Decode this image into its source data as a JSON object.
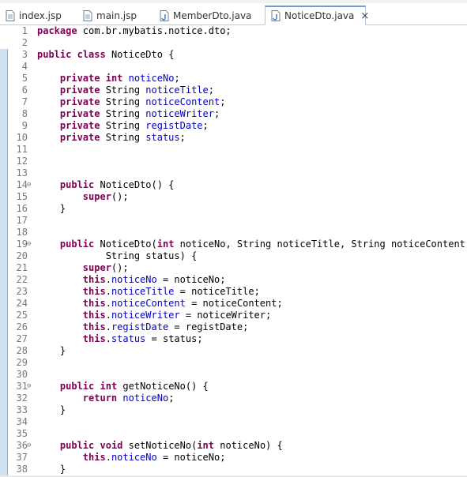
{
  "tabs": [
    {
      "label": "index.jsp",
      "icon": "jsp-file-icon",
      "active": false
    },
    {
      "label": "main.jsp",
      "icon": "jsp-file-icon",
      "active": false
    },
    {
      "label": "MemberDto.java",
      "icon": "java-file-icon",
      "active": false
    },
    {
      "label": "NoticeDto.java",
      "icon": "java-file-icon",
      "active": true,
      "close": "×"
    }
  ],
  "colors": {
    "keyword": "#7f0055",
    "field": "#0000c0",
    "plain": "#000000",
    "line_number": "#787878",
    "change_bar": "#cfe0f1"
  },
  "code_lines": [
    {
      "n": "1",
      "segs": [
        [
          "kw",
          "package"
        ],
        [
          "t",
          " com.br.mybatis.notice.dto;"
        ]
      ]
    },
    {
      "n": "2",
      "segs": []
    },
    {
      "n": "3",
      "segs": [
        [
          "kw",
          "public"
        ],
        [
          "t",
          " "
        ],
        [
          "kw",
          "class"
        ],
        [
          "t",
          " NoticeDto {"
        ]
      ]
    },
    {
      "n": "4",
      "segs": []
    },
    {
      "n": "5",
      "segs": [
        [
          "t",
          "    "
        ],
        [
          "kw",
          "private"
        ],
        [
          "t",
          " "
        ],
        [
          "kw",
          "int"
        ],
        [
          "t",
          " "
        ],
        [
          "fd",
          "noticeNo"
        ],
        [
          "t",
          ";"
        ]
      ]
    },
    {
      "n": "6",
      "segs": [
        [
          "t",
          "    "
        ],
        [
          "kw",
          "private"
        ],
        [
          "t",
          " String "
        ],
        [
          "fd",
          "noticeTitle"
        ],
        [
          "t",
          ";"
        ]
      ]
    },
    {
      "n": "7",
      "segs": [
        [
          "t",
          "    "
        ],
        [
          "kw",
          "private"
        ],
        [
          "t",
          " String "
        ],
        [
          "fd",
          "noticeContent"
        ],
        [
          "t",
          ";"
        ]
      ]
    },
    {
      "n": "8",
      "segs": [
        [
          "t",
          "    "
        ],
        [
          "kw",
          "private"
        ],
        [
          "t",
          " String "
        ],
        [
          "fd",
          "noticeWriter"
        ],
        [
          "t",
          ";"
        ]
      ]
    },
    {
      "n": "9",
      "segs": [
        [
          "t",
          "    "
        ],
        [
          "kw",
          "private"
        ],
        [
          "t",
          " String "
        ],
        [
          "fd",
          "registDate"
        ],
        [
          "t",
          ";"
        ]
      ]
    },
    {
      "n": "10",
      "segs": [
        [
          "t",
          "    "
        ],
        [
          "kw",
          "private"
        ],
        [
          "t",
          " String "
        ],
        [
          "fd",
          "status"
        ],
        [
          "t",
          ";"
        ]
      ]
    },
    {
      "n": "11",
      "segs": []
    },
    {
      "n": "12",
      "segs": []
    },
    {
      "n": "13",
      "segs": []
    },
    {
      "n": "14",
      "fold": "⊖",
      "segs": [
        [
          "t",
          "    "
        ],
        [
          "kw",
          "public"
        ],
        [
          "t",
          " NoticeDto() {"
        ]
      ]
    },
    {
      "n": "15",
      "segs": [
        [
          "t",
          "        "
        ],
        [
          "kw",
          "super"
        ],
        [
          "t",
          "();"
        ]
      ]
    },
    {
      "n": "16",
      "segs": [
        [
          "t",
          "    }"
        ]
      ]
    },
    {
      "n": "17",
      "segs": []
    },
    {
      "n": "18",
      "segs": []
    },
    {
      "n": "19",
      "fold": "⊖",
      "segs": [
        [
          "t",
          "    "
        ],
        [
          "kw",
          "public"
        ],
        [
          "t",
          " NoticeDto("
        ],
        [
          "kw",
          "int"
        ],
        [
          "t",
          " noticeNo, String noticeTitle, String noticeContent, String noticeWriter, String registDate,"
        ]
      ]
    },
    {
      "n": "20",
      "segs": [
        [
          "t",
          "            String status) {"
        ]
      ]
    },
    {
      "n": "21",
      "segs": [
        [
          "t",
          "        "
        ],
        [
          "kw",
          "super"
        ],
        [
          "t",
          "();"
        ]
      ]
    },
    {
      "n": "22",
      "segs": [
        [
          "t",
          "        "
        ],
        [
          "kw",
          "this"
        ],
        [
          "t",
          "."
        ],
        [
          "fd",
          "noticeNo"
        ],
        [
          "t",
          " = noticeNo;"
        ]
      ]
    },
    {
      "n": "23",
      "segs": [
        [
          "t",
          "        "
        ],
        [
          "kw",
          "this"
        ],
        [
          "t",
          "."
        ],
        [
          "fd",
          "noticeTitle"
        ],
        [
          "t",
          " = noticeTitle;"
        ]
      ]
    },
    {
      "n": "24",
      "segs": [
        [
          "t",
          "        "
        ],
        [
          "kw",
          "this"
        ],
        [
          "t",
          "."
        ],
        [
          "fd",
          "noticeContent"
        ],
        [
          "t",
          " = noticeContent;"
        ]
      ]
    },
    {
      "n": "25",
      "segs": [
        [
          "t",
          "        "
        ],
        [
          "kw",
          "this"
        ],
        [
          "t",
          "."
        ],
        [
          "fd",
          "noticeWriter"
        ],
        [
          "t",
          " = noticeWriter;"
        ]
      ]
    },
    {
      "n": "26",
      "segs": [
        [
          "t",
          "        "
        ],
        [
          "kw",
          "this"
        ],
        [
          "t",
          "."
        ],
        [
          "fd",
          "registDate"
        ],
        [
          "t",
          " = registDate;"
        ]
      ]
    },
    {
      "n": "27",
      "segs": [
        [
          "t",
          "        "
        ],
        [
          "kw",
          "this"
        ],
        [
          "t",
          "."
        ],
        [
          "fd",
          "status"
        ],
        [
          "t",
          " = status;"
        ]
      ]
    },
    {
      "n": "28",
      "segs": [
        [
          "t",
          "    }"
        ]
      ]
    },
    {
      "n": "29",
      "segs": []
    },
    {
      "n": "30",
      "segs": []
    },
    {
      "n": "31",
      "fold": "⊖",
      "segs": [
        [
          "t",
          "    "
        ],
        [
          "kw",
          "public"
        ],
        [
          "t",
          " "
        ],
        [
          "kw",
          "int"
        ],
        [
          "t",
          " getNoticeNo() {"
        ]
      ]
    },
    {
      "n": "32",
      "segs": [
        [
          "t",
          "        "
        ],
        [
          "kw",
          "return"
        ],
        [
          "t",
          " "
        ],
        [
          "fd",
          "noticeNo"
        ],
        [
          "t",
          ";"
        ]
      ]
    },
    {
      "n": "33",
      "segs": [
        [
          "t",
          "    }"
        ]
      ]
    },
    {
      "n": "34",
      "segs": []
    },
    {
      "n": "35",
      "segs": []
    },
    {
      "n": "36",
      "fold": "⊖",
      "segs": [
        [
          "t",
          "    "
        ],
        [
          "kw",
          "public"
        ],
        [
          "t",
          " "
        ],
        [
          "kw",
          "void"
        ],
        [
          "t",
          " setNoticeNo("
        ],
        [
          "kw",
          "int"
        ],
        [
          "t",
          " noticeNo) {"
        ]
      ]
    },
    {
      "n": "37",
      "segs": [
        [
          "t",
          "        "
        ],
        [
          "kw",
          "this"
        ],
        [
          "t",
          "."
        ],
        [
          "fd",
          "noticeNo"
        ],
        [
          "t",
          " = noticeNo;"
        ]
      ]
    },
    {
      "n": "38",
      "segs": [
        [
          "t",
          "    }"
        ]
      ]
    }
  ]
}
